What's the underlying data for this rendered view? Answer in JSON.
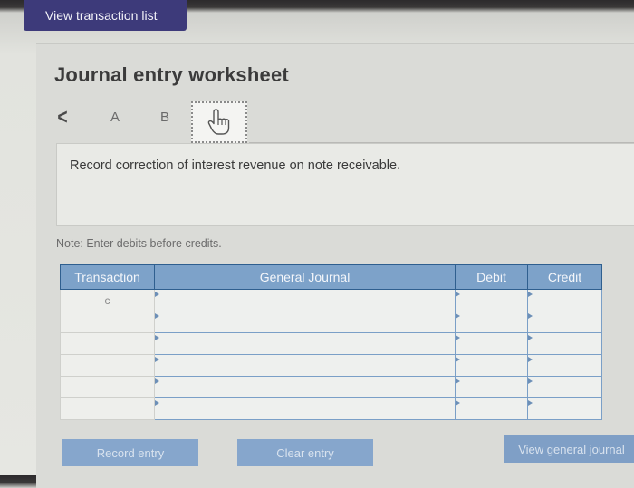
{
  "header": {
    "view_transactions_label": "View transaction list"
  },
  "worksheet": {
    "title": "Journal entry worksheet",
    "tabs": [
      {
        "label": "A"
      },
      {
        "label": "B"
      }
    ],
    "active_tab_icon": "hand-pointer-icon",
    "description": "Record correction of interest revenue on note receivable.",
    "note": "Note: Enter debits before credits."
  },
  "table": {
    "columns": [
      "Transaction",
      "General Journal",
      "Debit",
      "Credit"
    ],
    "rows": [
      {
        "transaction": "c",
        "account": "",
        "debit": "",
        "credit": ""
      },
      {
        "transaction": "",
        "account": "",
        "debit": "",
        "credit": ""
      },
      {
        "transaction": "",
        "account": "",
        "debit": "",
        "credit": ""
      },
      {
        "transaction": "",
        "account": "",
        "debit": "",
        "credit": ""
      },
      {
        "transaction": "",
        "account": "",
        "debit": "",
        "credit": ""
      },
      {
        "transaction": "",
        "account": "",
        "debit": "",
        "credit": ""
      }
    ]
  },
  "buttons": {
    "record": "Record entry",
    "clear": "Clear entry",
    "view_general_journal": "View general journal"
  },
  "colors": {
    "header_button": "#3d3a7a",
    "table_header": "#7da2c9",
    "action_button": "#86a6cc"
  }
}
